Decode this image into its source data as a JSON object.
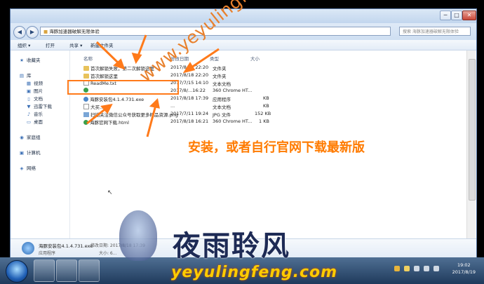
{
  "window": {
    "address": "海豚加速器破解无限体验",
    "search_placeholder": "搜索 海豚加速器破解无限体验",
    "buttons": {
      "minimize": "─",
      "maximize": "□",
      "close": "✕"
    }
  },
  "toolbar": {
    "organize": "组织 ▾",
    "open": "打开",
    "share": "共享 ▾",
    "new_folder": "新建文件夹"
  },
  "sidebar": {
    "favorites": "收藏夹",
    "library": "库",
    "library_items": [
      "视频",
      "图片",
      "文档",
      "迅雷下载",
      "音乐",
      "桌面"
    ],
    "homegroup": "家庭组",
    "computer": "计算机",
    "network": "网络"
  },
  "columns": {
    "name": "名称",
    "date": "修改日期",
    "type": "类型",
    "size": "大小"
  },
  "files": [
    {
      "name": "首次解锁失败，第二次解锁这里",
      "date": "2017/8/18 22:20",
      "type": "文件夹",
      "size": "",
      "icon": "folder"
    },
    {
      "name": "首次解锁这里",
      "date": "2017/8/18 22:20",
      "type": "文件夹",
      "size": "",
      "icon": "folder"
    },
    {
      "name": "ReadMe.txt",
      "date": "2017/7/15 14:10",
      "type": "文本文档",
      "size": "",
      "icon": "txt"
    },
    {
      "name": "",
      "date": "2017/8/...16:22",
      "type": "360 Chrome HT...",
      "size": "",
      "icon": "html"
    },
    {
      "name": "海豚安装包4.1.4.731.exe",
      "date": "2017/8/18 17:39",
      "type": "应用程序",
      "size": "KB",
      "icon": "exe"
    },
    {
      "name": "大买...",
      "date": "...",
      "type": "文本文档",
      "size": "KB",
      "icon": "txt"
    },
    {
      "name": "扫描关注微信公众号获取更多精品资源.png",
      "date": "2017/7/11 19:24",
      "type": "JPG 文件",
      "size": "152 KB",
      "icon": "img"
    },
    {
      "name": "海豚官网下载.html",
      "date": "2017/8/18 16:21",
      "type": "360 Chrome HT...",
      "size": "1 KB",
      "icon": "html"
    }
  ],
  "details": {
    "filename": "海豚安装包4.1.4.731.exe",
    "modified_label": "修改日期: 2017/8/18 17:39",
    "type": "应用程序",
    "size_label": "大小: 6..."
  },
  "taskbar": {
    "time": "19:02",
    "date": "2017/8/19"
  },
  "watermark": {
    "url": "www.yeyulingfeng.com",
    "note": "安装，或者自行官网下载最新版",
    "logo_cn": "夜雨聆风",
    "logo_en": "yeyulingfeng.com"
  },
  "colors": {
    "accent": "#ff7a1a",
    "titlebar": "#c2d6ee",
    "taskbar": "#1f3a5c"
  }
}
